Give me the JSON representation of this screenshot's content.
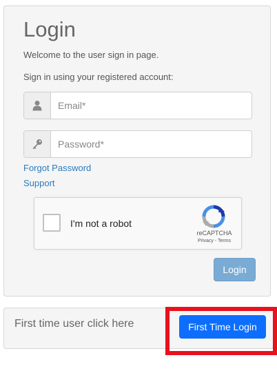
{
  "login_panel": {
    "title": "Login",
    "welcome_text": "Welcome to the user sign in page.",
    "signin_text": "Sign in using your registered account:",
    "email": {
      "placeholder": "Email*",
      "value": "",
      "icon": "user-icon"
    },
    "password": {
      "placeholder": "Password*",
      "value": "",
      "icon": "key-icon"
    },
    "forgot_password_link": "Forgot Password",
    "support_link": "Support",
    "recaptcha": {
      "checkbox_label": "I'm not a robot",
      "brand": "reCAPTCHA",
      "privacy": "Privacy",
      "separator": " - ",
      "terms": "Terms",
      "checked": false
    },
    "login_button": "Login",
    "colors": {
      "link": "#2a7bbd",
      "login_button": "#7aabd4"
    }
  },
  "first_time_panel": {
    "text": "First time user click here",
    "button": "First Time Login",
    "colors": {
      "button": "#0d6efd",
      "highlight": "#e8111c"
    }
  }
}
